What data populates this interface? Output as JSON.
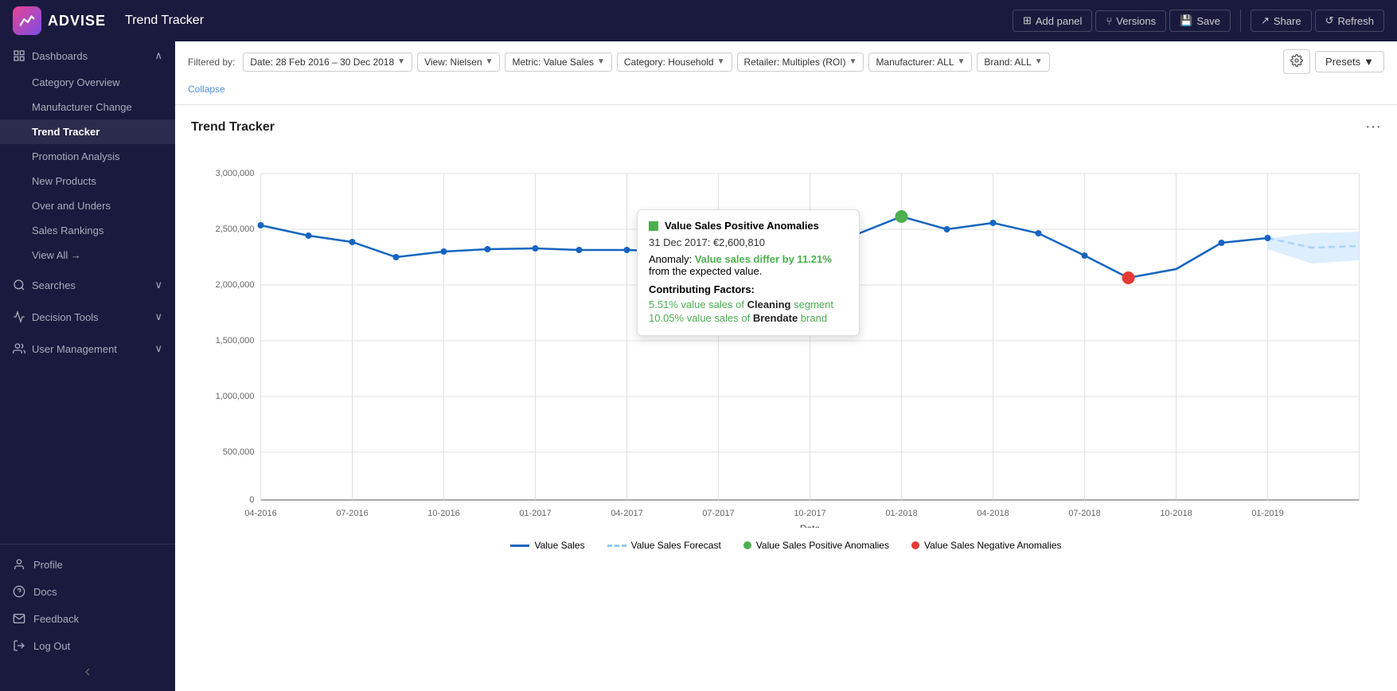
{
  "app": {
    "logo_text": "ADVISE",
    "page_title": "Trend Tracker"
  },
  "topbar": {
    "add_panel_label": "Add panel",
    "versions_label": "Versions",
    "save_label": "Save",
    "share_label": "Share",
    "refresh_label": "Refresh"
  },
  "filters": {
    "label": "Filtered by:",
    "date": "Date: 28 Feb 2016 – 30 Dec 2018",
    "view": "View: Nielsen",
    "metric": "Metric: Value Sales",
    "category": "Category: Household",
    "retailer": "Retailer: Multiples (ROI)",
    "manufacturer": "Manufacturer: ALL",
    "brand": "Brand: ALL",
    "collapse": "Collapse",
    "presets": "Presets"
  },
  "sidebar": {
    "dashboards_label": "Dashboards",
    "searches_label": "Searches",
    "decision_tools_label": "Decision Tools",
    "user_management_label": "User Management",
    "nav_items": [
      {
        "label": "Category Overview",
        "active": false
      },
      {
        "label": "Manufacturer Change",
        "active": false
      },
      {
        "label": "Trend Tracker",
        "active": true
      },
      {
        "label": "Promotion Analysis",
        "active": false
      },
      {
        "label": "New Products",
        "active": false
      },
      {
        "label": "Over and Unders",
        "active": false
      },
      {
        "label": "Sales Rankings",
        "active": false
      },
      {
        "label": "View All →",
        "active": false
      }
    ],
    "bottom_items": [
      {
        "label": "Profile",
        "icon": "user"
      },
      {
        "label": "Docs",
        "icon": "question"
      },
      {
        "label": "Feedback",
        "icon": "mail"
      },
      {
        "label": "Log Out",
        "icon": "logout"
      }
    ]
  },
  "chart": {
    "title": "Trend Tracker",
    "x_label": "Date",
    "y_labels": [
      "3,000,000",
      "2,500,000",
      "2,000,000",
      "1,500,000",
      "1,000,000",
      "500,000",
      "0"
    ],
    "x_ticks": [
      "04-2016",
      "07-2016",
      "10-2016",
      "01-2017",
      "04-2017",
      "07-2017",
      "10-2017",
      "01-2018",
      "04-2018",
      "07-2018",
      "10-2018",
      "01-2019"
    ]
  },
  "tooltip": {
    "title": "Value Sales Positive Anomalies",
    "date": "31 Dec 2017: €2,600,810",
    "anomaly_prefix": "Anomaly: ",
    "anomaly_highlight": "Value sales differ by 11.21%",
    "anomaly_suffix": " from the expected value.",
    "contributing_header": "Contributing Factors:",
    "factor1_pct": "5.51% value sales",
    "factor1_segment": "Cleaning",
    "factor1_suffix": " segment",
    "factor2_pct": "10.05% value sales",
    "factor2_brand": "Brendate",
    "factor2_suffix": " brand"
  },
  "legend": {
    "value_sales": "Value Sales",
    "forecast": "Value Sales Forecast",
    "positive": "Value Sales Positive Anomalies",
    "negative": "Value Sales Negative Anomalies"
  }
}
